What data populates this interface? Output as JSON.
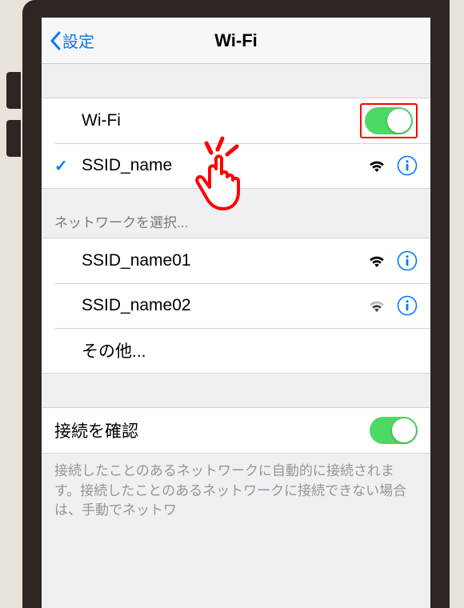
{
  "navbar": {
    "back_label": "設定",
    "title": "Wi-Fi"
  },
  "wifi_toggle": {
    "label": "Wi-Fi",
    "on": true
  },
  "connected": {
    "ssid": "SSID_name"
  },
  "choose_network_header": "ネットワークを選択...",
  "networks": [
    {
      "ssid": "SSID_name01"
    },
    {
      "ssid": "SSID_name02"
    }
  ],
  "other_label": "その他...",
  "ask_to_join": {
    "label": "接続を確認",
    "on": true
  },
  "footer": "接続したことのあるネットワークに自動的に接続されます。接続したことのあるネットワークに接続できない場合は、手動でネットワ"
}
